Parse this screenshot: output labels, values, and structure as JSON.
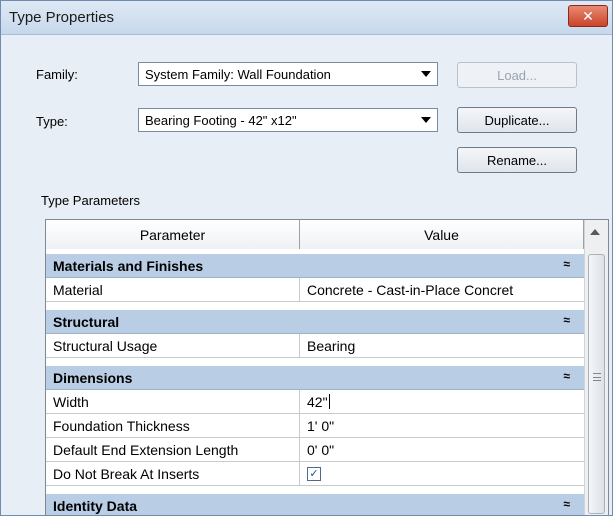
{
  "window": {
    "title": "Type Properties",
    "close_glyph": "✕"
  },
  "family": {
    "label": "Family:",
    "value": "System Family: Wall Foundation"
  },
  "type": {
    "label": "Type:",
    "value": "Bearing Footing - 42\" x12\""
  },
  "buttons": {
    "load": "Load...",
    "duplicate": "Duplicate...",
    "rename": "Rename..."
  },
  "section_title": "Type Parameters",
  "grid": {
    "headers": [
      "Parameter",
      "Value"
    ],
    "groups": {
      "materials": "Materials and Finishes",
      "structural": "Structural",
      "dimensions": "Dimensions",
      "identity": "Identity Data"
    },
    "collapse_glyph": "≈",
    "rows": {
      "material": {
        "param": "Material",
        "value": "Concrete - Cast-in-Place Concret"
      },
      "usage": {
        "param": "Structural Usage",
        "value": "Bearing"
      },
      "width": {
        "param": "Width",
        "value": "42\""
      },
      "thickness": {
        "param": "Foundation Thickness",
        "value": "1'  0\""
      },
      "extension": {
        "param": "Default End Extension Length",
        "value": "0'  0\""
      },
      "no_break": {
        "param": "Do Not Break At Inserts",
        "checked": true
      }
    }
  }
}
